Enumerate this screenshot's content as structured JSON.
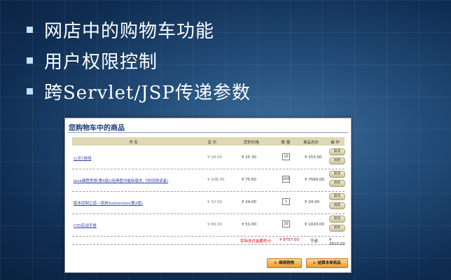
{
  "bullets": [
    "网店中的购物车功能",
    "用户权限控制",
    "跨Servlet/JSP传递参数"
  ],
  "cart": {
    "title": "您购物车中的商品",
    "headers": {
      "name": "书 名",
      "list_price": "定 价",
      "your_price": "您的价格",
      "qty": "数 量",
      "subtotal": "单品总价",
      "ops": "操 作"
    },
    "items": [
      {
        "name": "心灵7游戏",
        "list_price": "¥ 18.00",
        "your_price": "¥ 15.30",
        "qty": "10",
        "subtotal": "¥ 153.00"
      },
      {
        "name": "Java编程思想(第4版)(经典图书最新版本, 7折回馈读者)",
        "list_price": "¥ 108.00",
        "your_price": "¥ 75.60",
        "qty": "100",
        "subtotal": "¥ 7560.00"
      },
      {
        "name": "版本控制之道—使用Subversion(第2版)",
        "list_price": "¥ 32.00",
        "your_price": "¥ 24.00",
        "qty": "1",
        "subtotal": "¥ 24.00"
      },
      {
        "name": "CSS实战手册",
        "list_price": "¥ 68.00",
        "your_price": "¥ 51.00",
        "qty": "20",
        "subtotal": "¥ 1020.00"
      }
    ],
    "delete_label": "取消",
    "modify_label": "修改",
    "total_label": "实际支付金额总计:",
    "total_value": "¥ 8757.00",
    "save_label": "节省:",
    "save_value": "¥ 3615.00",
    "continue_label": "继续购物",
    "checkout_label": "结算本单商品",
    "colors": {
      "title": "#1a3f73",
      "header_bg": "#ded8b5",
      "total": "#cc0000",
      "button": "#ef9a2c"
    }
  }
}
